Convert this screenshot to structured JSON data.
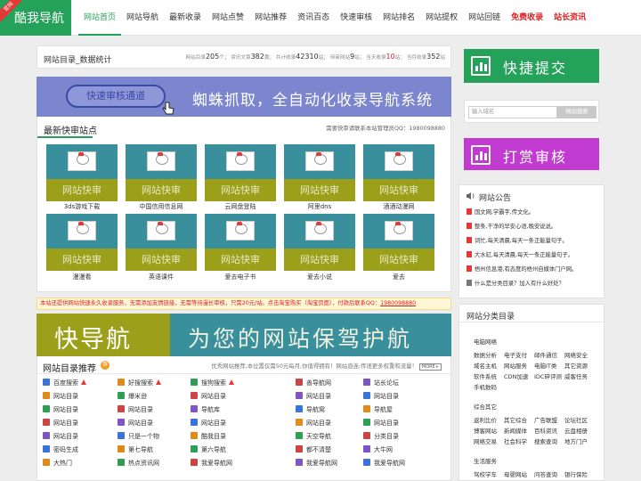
{
  "header": {
    "logo": "酷我导航",
    "ribbon": "官网",
    "nav": [
      {
        "label": "网站首页",
        "active": true
      },
      {
        "label": "网站导航"
      },
      {
        "label": "最新收录"
      },
      {
        "label": "网站点赞"
      },
      {
        "label": "网站推荐"
      },
      {
        "label": "资讯百态"
      },
      {
        "label": "快速审核"
      },
      {
        "label": "网站排名"
      },
      {
        "label": "网站提权"
      },
      {
        "label": "网站回链"
      },
      {
        "label": "免费收录",
        "red": true
      },
      {
        "label": "站长资讯",
        "red": true
      }
    ]
  },
  "stats": {
    "title": "网站目录_数据统计",
    "items": [
      {
        "label": "网站目录",
        "value": "205",
        "unit": "个；"
      },
      {
        "label": "资讯文章",
        "value": "382",
        "unit": "篇；"
      },
      {
        "label": "共计收录",
        "value": "42310",
        "unit": "站；"
      },
      {
        "label": "待审网站",
        "value": "9",
        "unit": "站；"
      },
      {
        "label": "当天收录",
        "value": "10",
        "unit": "站；",
        "red": true
      },
      {
        "label": "当月收录",
        "value": "352",
        "unit": "站"
      }
    ]
  },
  "banner1": {
    "button": "快速审核通道",
    "text": "蜘蛛抓取，全自动化收录导航系统"
  },
  "fast": {
    "title": "最新快审站点",
    "note": "需要快审请联系本站管理员QQ：1980098880",
    "badge": "网站快审",
    "sites": [
      "3ds游戏下载",
      "中国信用信息网",
      "云网盘登陆",
      "阿里dns",
      "酒酒动漫网",
      "漫漫看",
      "英语课件",
      "爱去电子书",
      "爱去小说",
      "爱去"
    ]
  },
  "notice": {
    "text": "本站还提供网站快速永久收录服务，无需添加友情链接，无需等待漫长审核，只需20元/站。点击淘宝购买（淘宝页面），付款后联系QQ：",
    "qq": "1980098880"
  },
  "banner2": {
    "left": "快导航",
    "right": "为您的网站保驾护航"
  },
  "directory": {
    "title": "网站目录推荐",
    "badge": "荐",
    "note": "优秀网站推荐,本位置仅需50元每月,你值得拥有！网站直连,传递更多权重和流量！",
    "more": "MORE+",
    "rows": [
      [
        "百度搜索",
        "好搜搜索",
        "搜狗搜索",
        "善导航网",
        "站长论坛"
      ],
      [
        "网站目录",
        "爆米逊",
        "网站目录",
        "网站目录",
        "网站目录"
      ],
      [
        "网站目录",
        "网站目录",
        "导航库",
        "导航窝",
        "导航屋"
      ],
      [
        "网站目录",
        "网站目录",
        "网站目录",
        "网站目录",
        "网站目录"
      ],
      [
        "网站目录",
        "只是一个物",
        "酷我目录",
        "天空导航",
        "分类目录"
      ],
      [
        "密码生成",
        "第七导航",
        "第六导航",
        "都不清楚",
        "大牛网"
      ],
      [
        "大热门",
        "热点资讯网",
        "我爱导航网",
        "我爱导航网",
        "我爱导航网"
      ]
    ]
  },
  "sidebar": {
    "quick_submit": "快捷提交",
    "search_placeholder": "输入域名",
    "search_button": "网站搜索",
    "reward": "打赏审核",
    "announce_title": "网站公告",
    "announcements": [
      "国文网,学霸字,传文化。",
      "整条,干净的早安心语,晚安说说。",
      "词忙,每天清晨,每天一条正能量句子。",
      "大水缸,每天清晨,每天一条正能量句子。",
      "梧州信息港,有态度的梧州自媒体门户网。",
      "什么是分类目录？加入有什么好处？"
    ],
    "category_title": "网站分类目录",
    "categories": [
      {
        "name": "电脑网络",
        "items": [
          "数据分析",
          "电子支付",
          "邮件通信",
          "网络安全",
          "域名主机",
          "网站服务",
          "电脑IT类",
          "其它资源",
          "软件系统",
          "CDN加速",
          "IDC碎评测",
          "威客任务",
          "手机数码"
        ]
      },
      {
        "name": "综合其它",
        "items": [
          "返利比价",
          "其它综合",
          "广告联盟",
          "论坛社区",
          "博客网站",
          "新闻媒体",
          "百科资讯",
          "云盘相册",
          "网络交易",
          "社会科学",
          "搜索查询",
          "地方门户"
        ]
      },
      {
        "name": "生活服务",
        "items": [
          "驾校学车",
          "母婴网站",
          "问答查询",
          "银行保险",
          "金融财经",
          "影楼婚纱",
          "家政建材",
          "宠物玩具"
        ]
      }
    ]
  }
}
